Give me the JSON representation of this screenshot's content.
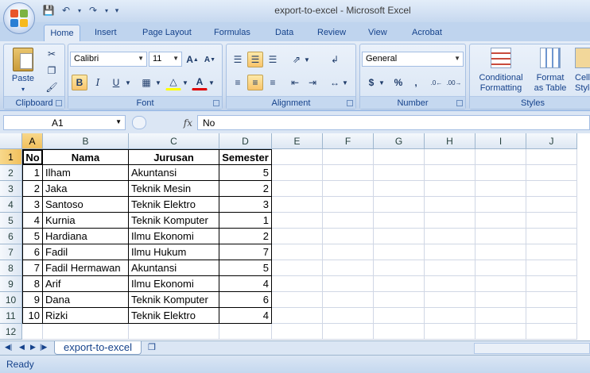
{
  "window": {
    "title": "export-to-excel - Microsoft Excel"
  },
  "ribbon": {
    "tabs": [
      "Home",
      "Insert",
      "Page Layout",
      "Formulas",
      "Data",
      "Review",
      "View",
      "Acrobat"
    ],
    "clipboard": {
      "label": "Clipboard",
      "paste": "Paste"
    },
    "font": {
      "label": "Font",
      "name": "Calibri",
      "size": "11"
    },
    "alignment": {
      "label": "Alignment"
    },
    "number": {
      "label": "Number",
      "format": "General",
      "currency": "$",
      "percent": "%",
      "comma": ","
    },
    "styles": {
      "label": "Styles",
      "cond1": "Conditional",
      "cond2": "Formatting",
      "fmt1": "Format",
      "fmt2": "as Table",
      "cell1": "Cell",
      "cell2": "Styles"
    }
  },
  "formula_bar": {
    "name_box": "A1",
    "fx": "fx",
    "value": "No"
  },
  "sheet": {
    "columns": [
      "A",
      "B",
      "C",
      "D",
      "E",
      "F",
      "G",
      "H",
      "I",
      "J"
    ],
    "rows": [
      "1",
      "2",
      "3",
      "4",
      "5",
      "6",
      "7",
      "8",
      "9",
      "10",
      "11",
      "12"
    ],
    "header": [
      "No",
      "Nama",
      "Jurusan",
      "Semester"
    ],
    "data": [
      [
        "1",
        "Ilham",
        "Akuntansi",
        "5"
      ],
      [
        "2",
        "Jaka",
        "Teknik Mesin",
        "2"
      ],
      [
        "3",
        "Santoso",
        "Teknik Elektro",
        "3"
      ],
      [
        "4",
        "Kurnia",
        "Teknik Komputer",
        "1"
      ],
      [
        "5",
        "Hardiana",
        "Ilmu Ekonomi",
        "2"
      ],
      [
        "6",
        "Fadil",
        "Ilmu Hukum",
        "7"
      ],
      [
        "7",
        "Fadil Hermawan",
        "Akuntansi",
        "5"
      ],
      [
        "8",
        "Arif",
        "Ilmu Ekonomi",
        "4"
      ],
      [
        "9",
        "Dana",
        "Teknik Komputer",
        "6"
      ],
      [
        "10",
        "Rizki",
        "Teknik Elektro",
        "4"
      ]
    ]
  },
  "sheet_tabs": {
    "active": "export-to-excel"
  },
  "status": {
    "text": "Ready"
  }
}
